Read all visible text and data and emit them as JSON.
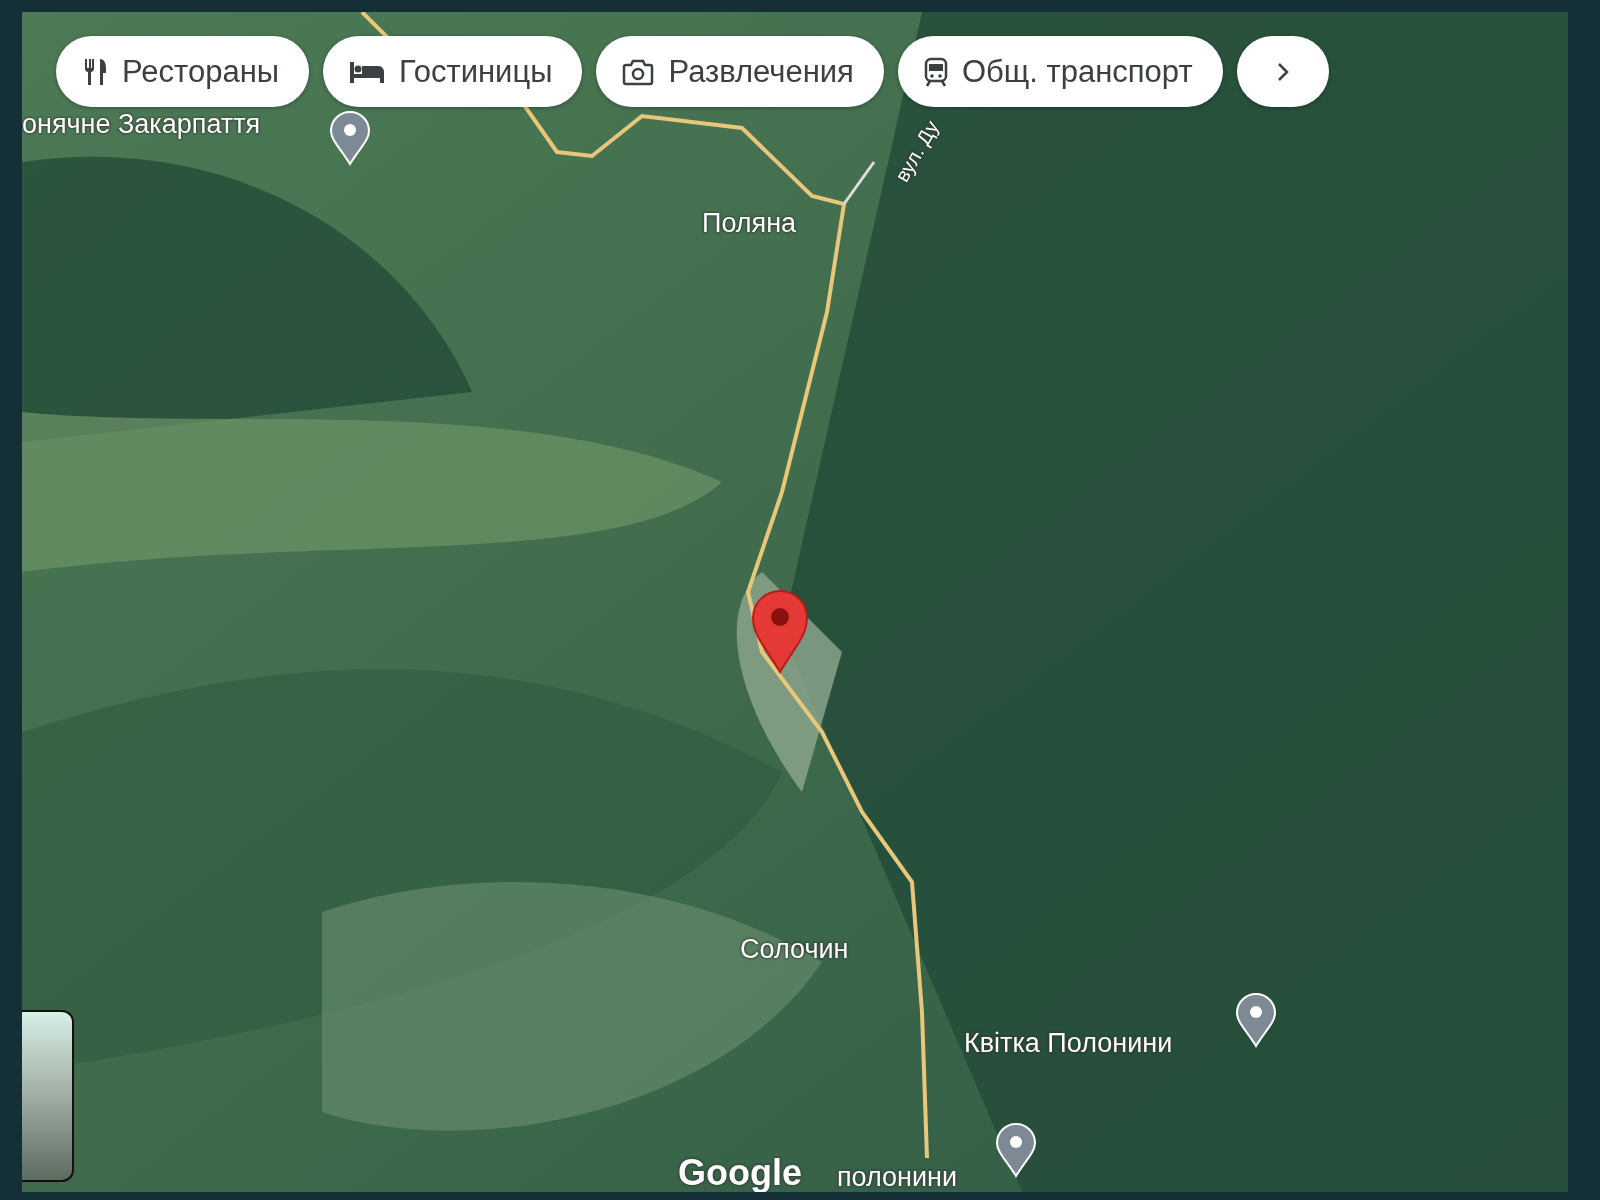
{
  "categories": [
    {
      "label": "Рестораны",
      "kind": "restaurant"
    },
    {
      "label": "Гостиницы",
      "kind": "hotel"
    },
    {
      "label": "Развлечения",
      "kind": "camera"
    },
    {
      "label": "Общ. транспорт",
      "kind": "transit"
    }
  ],
  "map": {
    "places": [
      {
        "name": "онячне Закарпаття",
        "kind": "poi"
      },
      {
        "name": "вул. Ду",
        "kind": "street"
      },
      {
        "name": "Поляна",
        "kind": "village"
      },
      {
        "name": "Солочин",
        "kind": "village"
      },
      {
        "name": "Квітка Полонини",
        "kind": "poi"
      },
      {
        "name": "полонини",
        "kind": "poi"
      }
    ],
    "logo": "Google"
  }
}
